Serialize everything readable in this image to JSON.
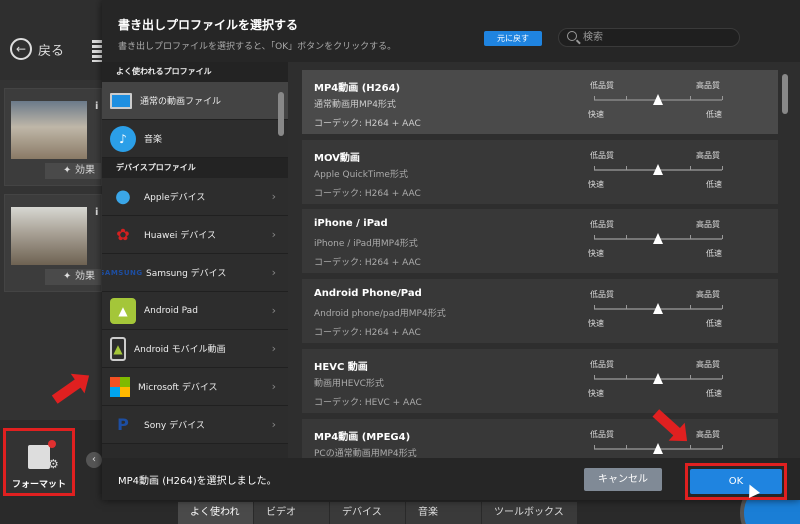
{
  "app": {
    "back_label": "戻る",
    "clip_effect_label": "効果",
    "format_label": "フォーマット",
    "bottom_tabs": [
      "よく使われる",
      "ビデオ",
      "デバイス",
      "音楽",
      "ツールボックス"
    ]
  },
  "dialog": {
    "title": "書き出しプロファイルを選択する",
    "subtitle": "書き出しプロファイルを選択すると、「OK」ボタンをクリックする。",
    "reset_label": "元に戻す",
    "search_placeholder": "検索",
    "categories": {
      "section_common": "よく使われるプロファイル",
      "section_device": "デバイスプロファイル",
      "common_items": [
        {
          "label": "通常の動画ファイル",
          "icon": "monitor-icon",
          "active": true
        },
        {
          "label": "音楽",
          "icon": "music-icon"
        }
      ],
      "device_items": [
        {
          "label": "Appleデバイス",
          "icon": "apple-icon"
        },
        {
          "label": "Huawei デバイス",
          "icon": "huawei-icon"
        },
        {
          "label": "Samsung デバイス",
          "icon": "samsung-icon",
          "icon_text": "SAMSUNG"
        },
        {
          "label": "Android Pad",
          "icon": "android-icon"
        },
        {
          "label": "Android モバイル動画",
          "icon": "android-phone-icon"
        },
        {
          "label": "Microsoft デバイス",
          "icon": "microsoft-icon"
        },
        {
          "label": "Sony デバイス",
          "icon": "playstation-icon"
        }
      ]
    },
    "quality_low": "低品質",
    "quality_high": "高品質",
    "speed_fast": "快速",
    "speed_slow": "低速",
    "profiles": [
      {
        "name": "MP4動画 (H264)",
        "desc": "通常動画用MP4形式",
        "codec": "コーデック: H264 + AAC",
        "quality": 0.5
      },
      {
        "name": "MOV動画",
        "desc": "Apple QuickTime形式",
        "codec": "コーデック: H264 + AAC",
        "quality": 0.5
      },
      {
        "name": "iPhone / iPad",
        "desc": "iPhone / iPad用MP4形式",
        "codec": "コーデック: H264 + AAC",
        "quality": 0.5
      },
      {
        "name": "Android Phone/Pad",
        "desc": "Android phone/pad用MP4形式",
        "codec": "コーデック: H264 + AAC",
        "quality": 0.5
      },
      {
        "name": "HEVC 動画",
        "desc": "動画用HEVC形式",
        "codec": "コーデック: HEVC + AAC",
        "quality": 0.5
      },
      {
        "name": "MP4動画 (MPEG4)",
        "desc": "PCの通常動画用MP4形式",
        "codec": "",
        "quality": 0.5
      }
    ],
    "selected_text": "MP4動画 (H264)を選択しました。",
    "cancel_label": "キャンセル",
    "ok_label": "OK"
  },
  "colors": {
    "accent": "#1f84e0",
    "highlight": "#e02020"
  }
}
